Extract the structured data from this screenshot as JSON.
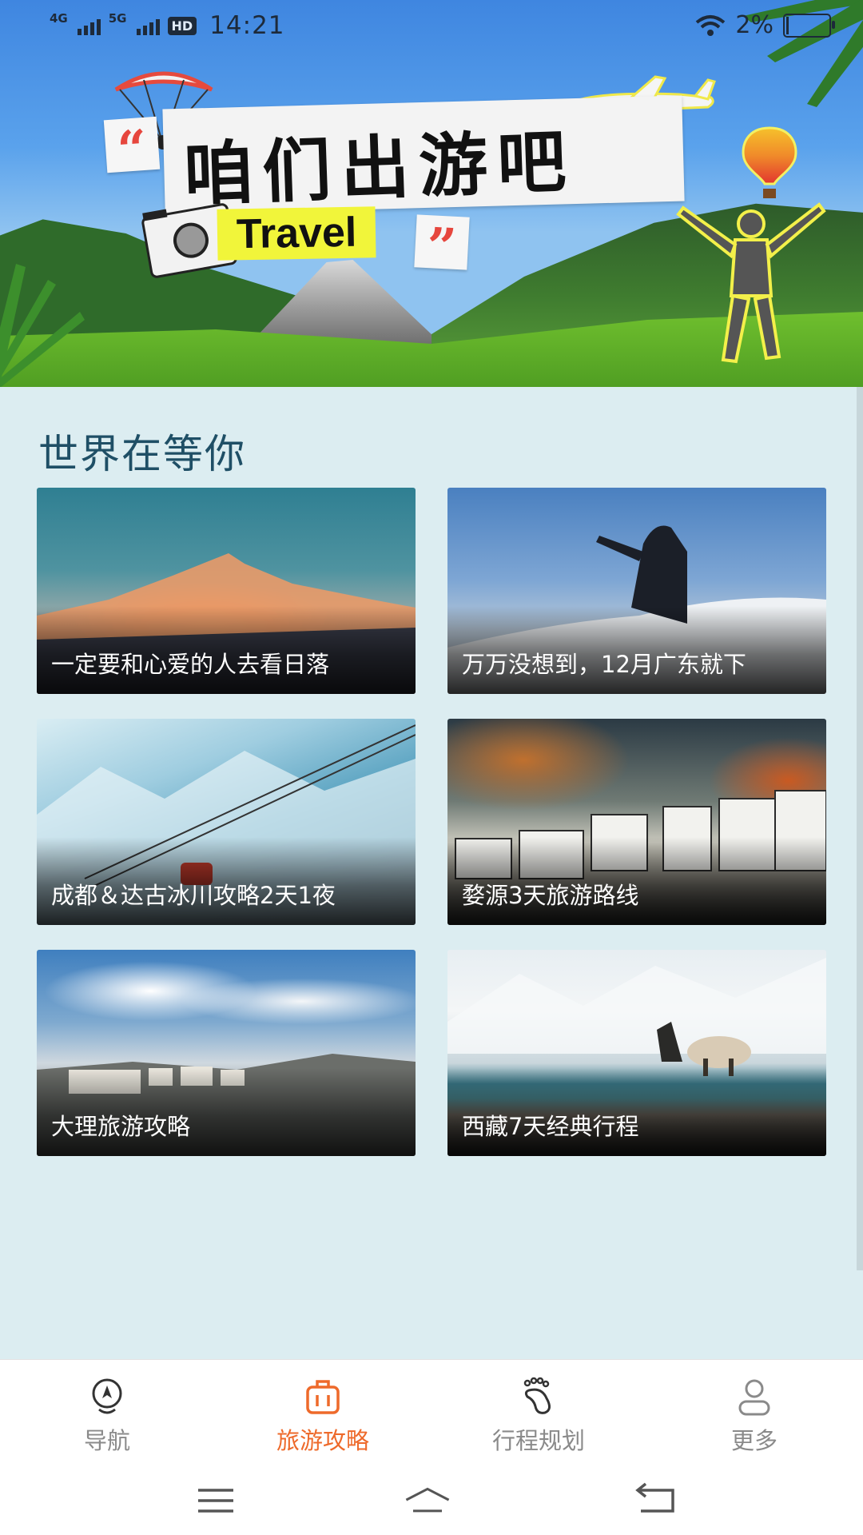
{
  "status_bar": {
    "network_1": "4G",
    "network_2": "5G",
    "hd_badge": "HD",
    "time": "14:21",
    "battery_text": "2%"
  },
  "banner": {
    "headline": "咱们出游吧",
    "tag": "Travel",
    "quote_open": "“",
    "quote_close": "”"
  },
  "section": {
    "title": "世界在等你"
  },
  "guides": [
    {
      "title": "一定要和心爱的人去看日落",
      "image": "sunset-snow-mountain"
    },
    {
      "title": "万万没想到，12月广东就下",
      "image": "frost-hill-photographer"
    },
    {
      "title": "成都＆达古冰川攻略2天1夜",
      "image": "glacier-cable-car"
    },
    {
      "title": "婺源3天旅游路线",
      "image": "huizhou-village-autumn"
    },
    {
      "title": "大理旅游攻略",
      "image": "dali-town-sky"
    },
    {
      "title": "西藏7天经典行程",
      "image": "tibet-lake-yak"
    }
  ],
  "bottom_nav": {
    "items": [
      {
        "label": "导航",
        "icon": "navigation-pin-icon",
        "active": false
      },
      {
        "label": "旅游攻略",
        "icon": "suitcase-icon",
        "active": true
      },
      {
        "label": "行程规划",
        "icon": "footprint-icon",
        "active": false
      },
      {
        "label": "更多",
        "icon": "user-icon",
        "active": false
      }
    ],
    "active_color": "#ee6a2b",
    "inactive_color": "#8a8a8a"
  },
  "system_nav": {
    "buttons": [
      "menu-icon",
      "home-icon",
      "back-icon"
    ]
  }
}
